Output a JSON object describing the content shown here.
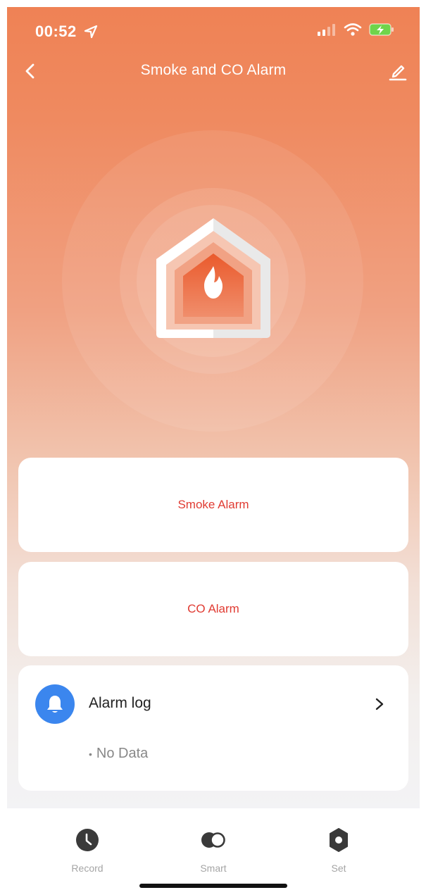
{
  "status": {
    "time": "00:52"
  },
  "header": {
    "title": "Smoke and CO Alarm"
  },
  "alarms": {
    "smoke_label": "Smoke Alarm",
    "co_label": "CO Alarm"
  },
  "alarm_log": {
    "title": "Alarm log",
    "empty_text": "No Data"
  },
  "tabs": [
    {
      "label": "Record",
      "icon": "clock-icon"
    },
    {
      "label": "Smart",
      "icon": "toggle-icon"
    },
    {
      "label": "Set",
      "icon": "gear-icon"
    }
  ],
  "colors": {
    "accent": "#ef8255",
    "alarm_text": "#e03b32",
    "log_icon_bg": "#3b86ee"
  }
}
